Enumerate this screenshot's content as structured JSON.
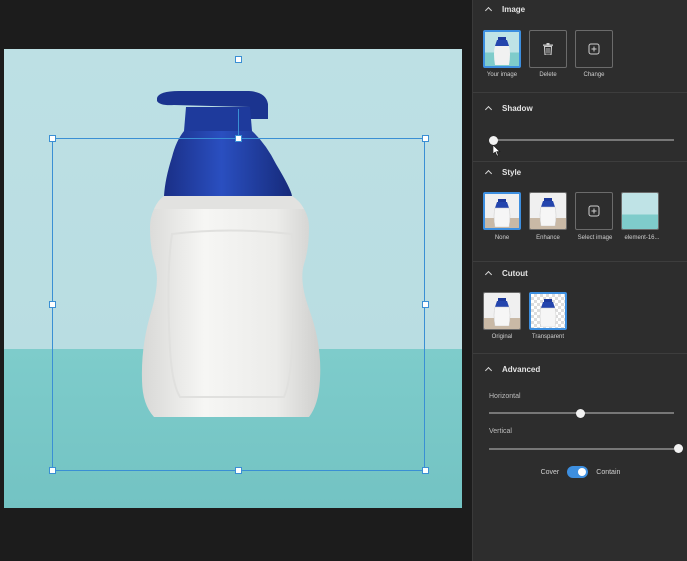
{
  "panel": {
    "image": {
      "title": "Image",
      "tiles": [
        {
          "label": "Your image"
        },
        {
          "label": "Delete"
        },
        {
          "label": "Change"
        }
      ]
    },
    "shadow": {
      "title": "Shadow",
      "value": 0
    },
    "style": {
      "title": "Style",
      "tiles": [
        {
          "label": "None"
        },
        {
          "label": "Enhance"
        },
        {
          "label": "Select image"
        },
        {
          "label": "element-16..."
        }
      ]
    },
    "cutout": {
      "title": "Cutout",
      "tiles": [
        {
          "label": "Original"
        },
        {
          "label": "Transparent"
        }
      ]
    },
    "advanced": {
      "title": "Advanced",
      "horizontal_label": "Horizontal",
      "horizontal_value": 0.49,
      "vertical_label": "Vertical",
      "vertical_value": 1.0,
      "cover_label": "Cover",
      "contain_label": "Contain",
      "mode": "contain"
    }
  },
  "colors": {
    "accent": "#3d8fe0",
    "panel_bg": "#2d2d2d",
    "canvas_bg": "#1c1c1c",
    "wall": "#bde0e4",
    "table": "#7ecccb",
    "cap": "#1f3f9e"
  }
}
